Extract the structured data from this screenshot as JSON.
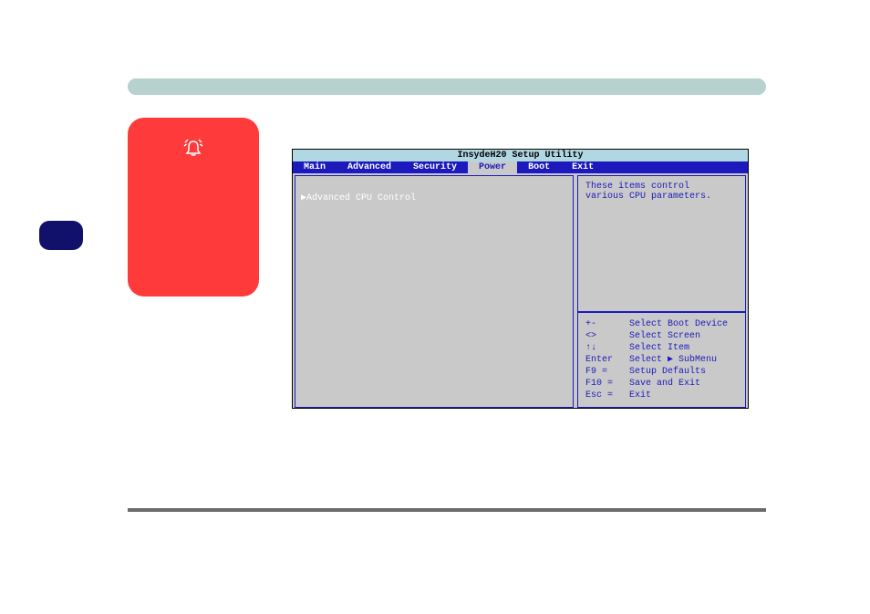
{
  "bios": {
    "title": "InsydeH20 Setup Utility",
    "tabs": {
      "main": "Main",
      "advanced": "Advanced",
      "security": "Security",
      "power": "Power",
      "boot": "Boot",
      "exit": "Exit"
    },
    "left": {
      "item1": "▶Advanced CPU Control"
    },
    "help": {
      "line1": "These items control",
      "line2": "various CPU parameters."
    },
    "keys": {
      "k1": "+-",
      "a1": "Select Boot Device",
      "k2": "<>",
      "a2": "Select Screen",
      "k3": "↑↓",
      "a3": "Select Item",
      "k4": "Enter",
      "a4": "Select ▶ SubMenu",
      "k5": "F9 =",
      "a5": "Setup Defaults",
      "k6": "F10 =",
      "a6": "Save and Exit",
      "k7": "Esc =",
      "a7": "Exit"
    }
  }
}
